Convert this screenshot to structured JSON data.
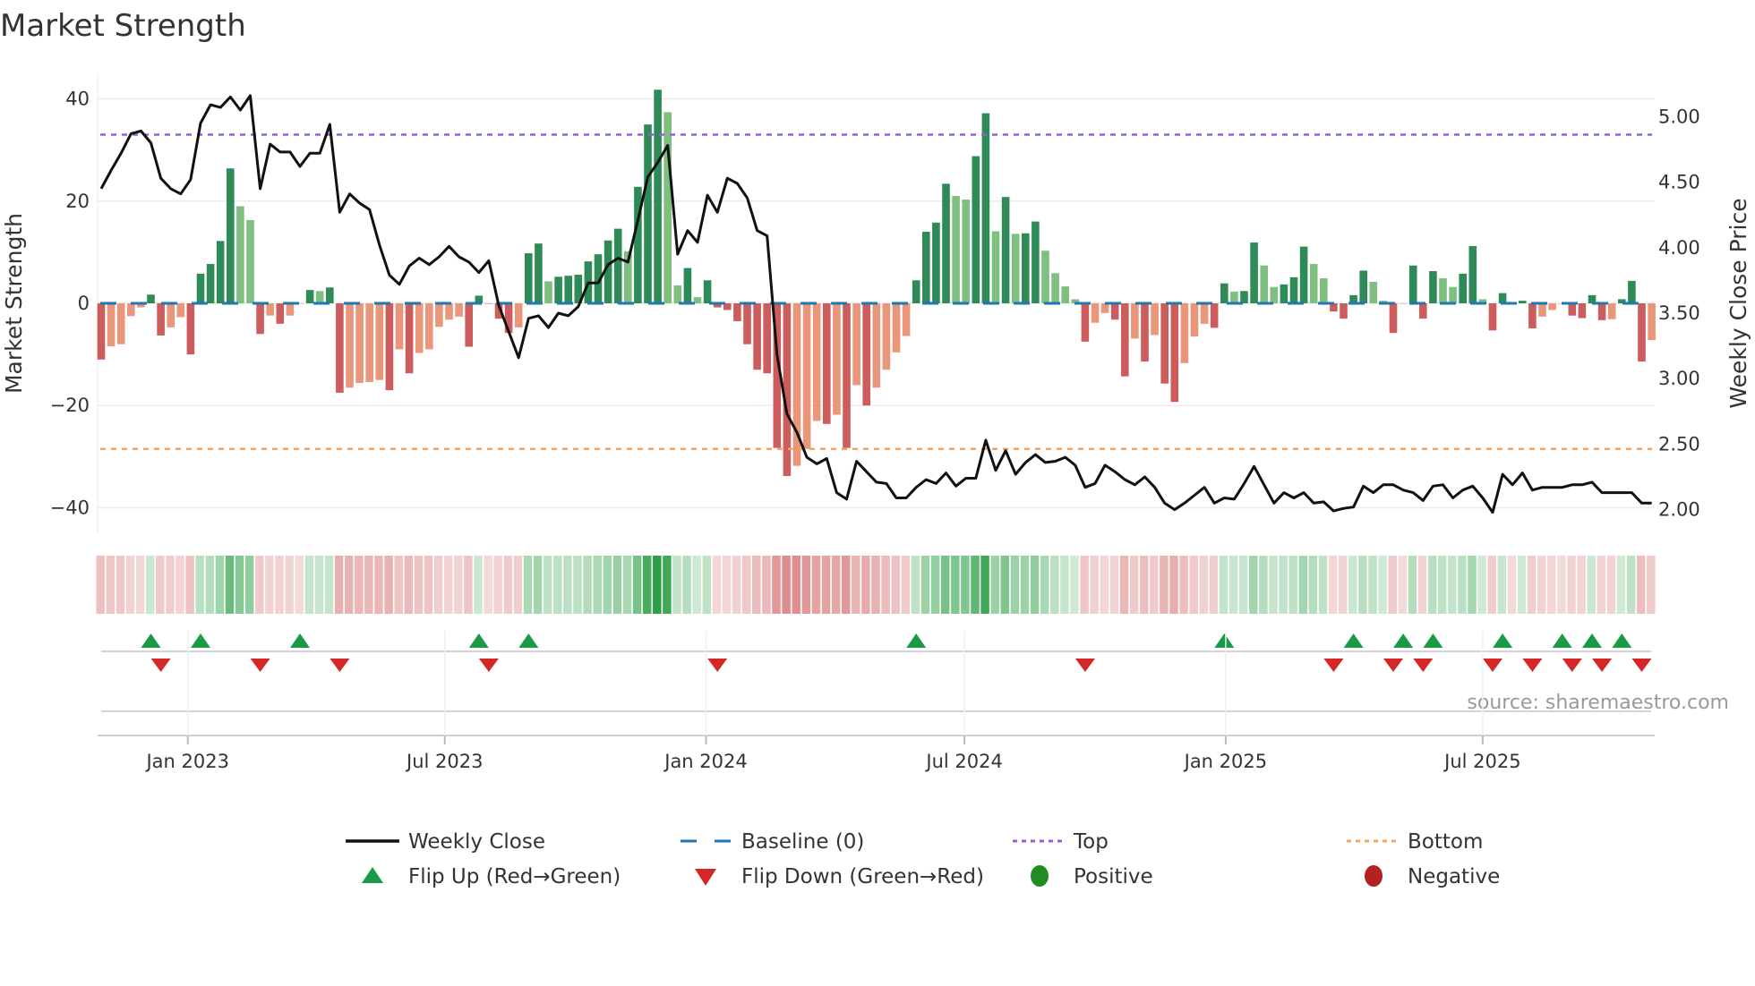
{
  "chart_data": {
    "type": "bar",
    "title": "Market Strength",
    "ylabel": "Market Strength",
    "y2label": "Weekly Close Price",
    "source": "source: sharemaestro.com",
    "x_start": "2022-11-01",
    "x_step_days": 7,
    "ylim": [
      -45,
      45
    ],
    "y2lim": [
      1.82,
      5.33
    ],
    "yticks": [
      {
        "v": 40,
        "label": "40"
      },
      {
        "v": 20,
        "label": "20"
      },
      {
        "v": 0,
        "label": "0"
      },
      {
        "v": -20,
        "label": "−20"
      },
      {
        "v": -40,
        "label": "−40"
      }
    ],
    "y2ticks": [
      {
        "v": 5.0,
        "label": "5.00"
      },
      {
        "v": 4.5,
        "label": "4.50"
      },
      {
        "v": 4.0,
        "label": "4.00"
      },
      {
        "v": 3.5,
        "label": "3.50"
      },
      {
        "v": 3.0,
        "label": "3.00"
      },
      {
        "v": 2.5,
        "label": "2.50"
      },
      {
        "v": 2.0,
        "label": "2.00"
      }
    ],
    "xticks": [
      {
        "date": "2023-01-01",
        "label": "Jan 2023"
      },
      {
        "date": "2023-07-01",
        "label": "Jul 2023"
      },
      {
        "date": "2024-01-01",
        "label": "Jan 2024"
      },
      {
        "date": "2024-07-01",
        "label": "Jul 2024"
      },
      {
        "date": "2025-01-01",
        "label": "Jan 2025"
      },
      {
        "date": "2025-07-01",
        "label": "Jul 2025"
      }
    ],
    "top_level": 33,
    "bottom_level": -28.5,
    "strength": [
      -11,
      -8.4,
      -8,
      -2.5,
      -0.8,
      1.7,
      -6.3,
      -4.7,
      -2.7,
      -10,
      5.8,
      7.7,
      12.2,
      26.4,
      19,
      16.3,
      -6,
      -2.4,
      -4,
      -2.4,
      0,
      2.6,
      2.4,
      3.1,
      -17.5,
      -16.5,
      -15.6,
      -15.4,
      -15,
      -17,
      -9,
      -13.7,
      -9.7,
      -9,
      -4.6,
      -3.2,
      -2.6,
      -8.5,
      1.5,
      0,
      -3,
      -5.8,
      -4.7,
      9.8,
      11.7,
      4.3,
      5.2,
      5.4,
      5.6,
      8.2,
      9.6,
      12.3,
      14.6,
      10.2,
      22.8,
      35,
      41.8,
      37.4,
      3.5,
      6.9,
      1.2,
      4.5,
      -0.8,
      -1.3,
      -3.5,
      -8,
      -13,
      -13.7,
      -28.3,
      -33.8,
      -31.8,
      -28.5,
      -23,
      -23.6,
      -21.8,
      -28.3,
      -16,
      -20,
      -16.5,
      -13,
      -9.6,
      -6.4,
      4.5,
      14,
      15.8,
      23.4,
      21,
      20.3,
      28.8,
      37.2,
      14.1,
      20.8,
      13.6,
      13.7,
      16,
      10.3,
      5.9,
      3.3,
      0.8,
      -7.5,
      -3.8,
      -1.9,
      -3.2,
      -14.3,
      -6.9,
      -11.4,
      -6.2,
      -15.7,
      -19.3,
      -11.7,
      -6.5,
      -4,
      -4.8,
      3.9,
      2.3,
      2.4,
      11.9,
      7.4,
      3.2,
      3.7,
      5.1,
      11.1,
      7.7,
      4.9,
      -1.6,
      -3,
      1.6,
      6.4,
      4.2,
      0.5,
      -5.8,
      0,
      7.4,
      -3,
      6.3,
      4.9,
      3.2,
      5.8,
      11.2,
      0.8,
      -5.3,
      2,
      0,
      0.5,
      -4.9,
      -2.6,
      -1.3,
      0,
      -2.4,
      -2.9,
      1.6,
      -3.3,
      -3.1,
      0.8,
      4.4,
      -11.4,
      -7.2
    ],
    "weekly_close": [
      4.45,
      4.59,
      4.72,
      4.87,
      4.89,
      4.8,
      4.53,
      4.45,
      4.41,
      4.52,
      4.95,
      5.09,
      5.07,
      5.15,
      5.05,
      5.16,
      4.45,
      4.79,
      4.73,
      4.73,
      4.62,
      4.72,
      4.72,
      4.94,
      4.27,
      4.41,
      4.34,
      4.29,
      4.02,
      3.79,
      3.72,
      3.86,
      3.92,
      3.87,
      3.93,
      4.01,
      3.93,
      3.89,
      3.81,
      3.9,
      3.56,
      3.36,
      3.16,
      3.46,
      3.48,
      3.39,
      3.5,
      3.48,
      3.55,
      3.73,
      3.73,
      3.87,
      3.92,
      3.89,
      4.21,
      4.54,
      4.65,
      4.78,
      3.95,
      4.13,
      4.04,
      4.4,
      4.27,
      4.53,
      4.49,
      4.38,
      4.13,
      4.09,
      3.18,
      2.73,
      2.59,
      2.4,
      2.35,
      2.39,
      2.13,
      2.08,
      2.37,
      2.29,
      2.21,
      2.2,
      2.09,
      2.09,
      2.17,
      2.23,
      2.2,
      2.28,
      2.18,
      2.24,
      2.24,
      2.53,
      2.3,
      2.45,
      2.27,
      2.36,
      2.42,
      2.36,
      2.37,
      2.4,
      2.34,
      2.17,
      2.2,
      2.34,
      2.29,
      2.23,
      2.19,
      2.25,
      2.17,
      2.05,
      2.0,
      2.05,
      2.11,
      2.17,
      2.05,
      2.09,
      2.08,
      2.2,
      2.33,
      2.19,
      2.05,
      2.13,
      2.09,
      2.13,
      2.05,
      2.06,
      1.99,
      2.01,
      2.02,
      2.18,
      2.13,
      2.19,
      2.19,
      2.15,
      2.13,
      2.07,
      2.18,
      2.19,
      2.09,
      2.15,
      2.18,
      2.09,
      1.98,
      2.27,
      2.19,
      2.28,
      2.15,
      2.17,
      2.17,
      2.17,
      2.19,
      2.19,
      2.21,
      2.13,
      2.13,
      2.13,
      2.13,
      2.05,
      2.05
    ],
    "flip_up_weeks": [
      5,
      10,
      20,
      38,
      43,
      82,
      113,
      126,
      131,
      134,
      141,
      147,
      150,
      153
    ],
    "flip_down_weeks": [
      6,
      16,
      24,
      39,
      62,
      99,
      124,
      130,
      133,
      140,
      144,
      148,
      151,
      155
    ],
    "legend": [
      {
        "label": "Weekly Close",
        "kind": "line"
      },
      {
        "label": "Baseline (0)",
        "kind": "baseline"
      },
      {
        "label": "Top",
        "kind": "top"
      },
      {
        "label": "Bottom",
        "kind": "bottom"
      },
      {
        "label": "Flip Up (Red→Green)",
        "kind": "up"
      },
      {
        "label": "Flip Down (Green→Red)",
        "kind": "down"
      },
      {
        "label": "Positive",
        "kind": "pos"
      },
      {
        "label": "Negative",
        "kind": "neg"
      }
    ],
    "legend_placement": "bottom",
    "grid": true
  },
  "colors": {
    "pos_rising": "#2e8b57",
    "pos_falling": "#7fbf7f",
    "neg_falling": "#cd5c5c",
    "neg_rising": "#e9967a",
    "baseline": "#1f77b4",
    "top": "#9a5fd6",
    "bottom": "#f4a460",
    "price": "#111111",
    "flip_up": "#1a9a44",
    "flip_down": "#d62728",
    "positive": "#228b22",
    "negative": "#b22222"
  }
}
